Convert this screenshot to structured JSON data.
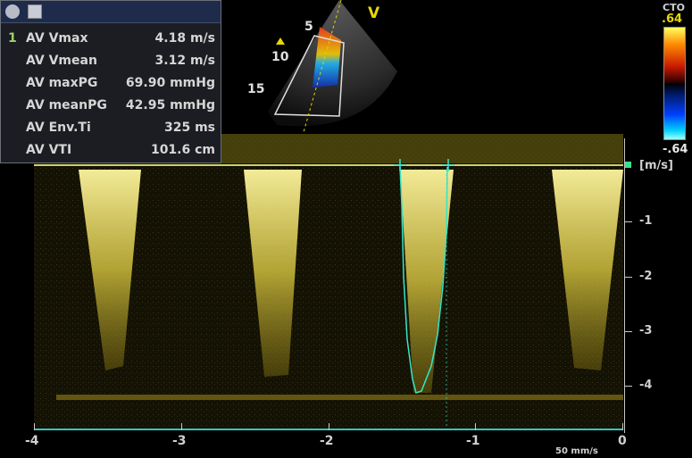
{
  "measurements": [
    {
      "index": "1",
      "label": "AV Vmax",
      "value": "4.18 m/s"
    },
    {
      "index": "",
      "label": "AV Vmean",
      "value": "3.12 m/s"
    },
    {
      "index": "",
      "label": "AV maxPG",
      "value": "69.90 mmHg"
    },
    {
      "index": "",
      "label": "AV meanPG",
      "value": "42.95 mmHg"
    },
    {
      "index": "",
      "label": "AV Env.Ti",
      "value": "325 ms"
    },
    {
      "index": "",
      "label": "AV VTI",
      "value": "101.6 cm"
    }
  ],
  "image_view": {
    "orientation_marker": "V",
    "depth_labels": [
      "5",
      "10",
      "15"
    ]
  },
  "color_scale": {
    "title": "CTO",
    "top": ".64",
    "bottom": "-.64"
  },
  "velocity_axis": {
    "unit": "[m/s]",
    "ticks": [
      "-1",
      "-2",
      "-3",
      "-4"
    ]
  },
  "time_axis": {
    "ticks": [
      "-4",
      "-3",
      "-2",
      "-1",
      "0"
    ],
    "sweep": "50 mm/s"
  },
  "colors": {
    "trace": "#35e6c8",
    "doppler": "#e6d85a",
    "axis": "#c8c8c8"
  }
}
